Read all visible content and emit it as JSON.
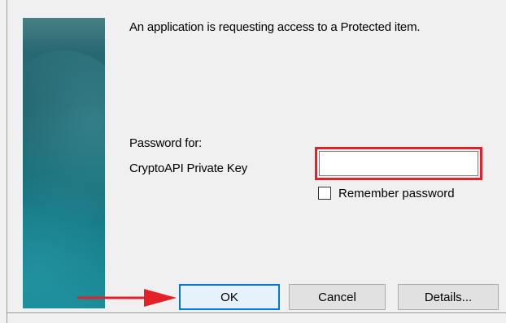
{
  "dialog": {
    "message": "An application is requesting access to a Protected item.",
    "password_for_label": "Password for:",
    "password_target": "CryptoAPI Private Key",
    "password_input": {
      "value": "",
      "placeholder": ""
    },
    "remember_password": {
      "label": "Remember password",
      "checked": false
    },
    "buttons": {
      "ok": "OK",
      "cancel": "Cancel",
      "details": "Details..."
    }
  },
  "colors": {
    "highlight": "#e4202a",
    "arrow": "#e4202a",
    "banner": "#1f6f7a",
    "focus_border": "#0078d7"
  }
}
